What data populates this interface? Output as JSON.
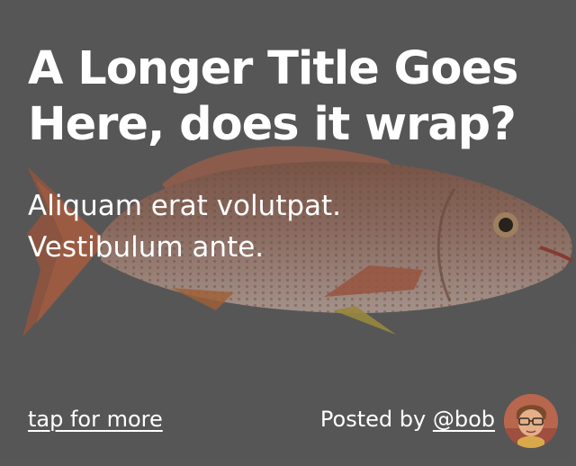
{
  "card": {
    "title": "A Longer Title Goes Here, does it wrap?",
    "subtitle": "Aliquam erat volutpat. Vestibulum ante.",
    "more_link": "tap for more",
    "posted_by_prefix": "Posted by ",
    "author_handle": "@bob",
    "background_image": "red-snapper-fish",
    "avatar_image": "boy-with-glasses-avatar"
  },
  "colors": {
    "background": "#5e5e5e",
    "text": "#ffffff"
  }
}
